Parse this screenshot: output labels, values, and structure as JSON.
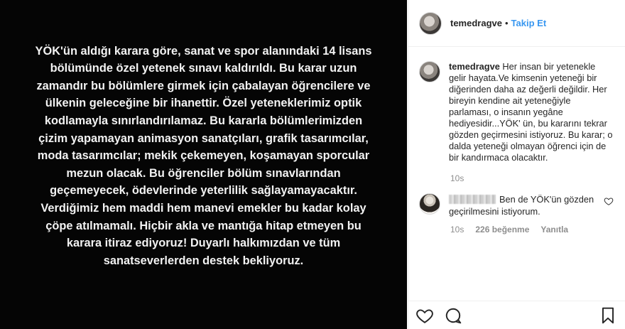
{
  "post": {
    "image_text": "YÖK'ün aldığı karara göre, sanat ve spor alanındaki 14 lisans\nbölümünde özel yetenek sınavı kaldırıldı. Bu karar uzun\nzamandır bu bölümlere girmek için çabalayan öğrencilere ve\nülkenin geleceğine bir ihanettir. Özel yeteneklerimiz optik\nkodlamayla sınırlandırılamaz. Bu kararla bölümlerimizden\nçizim yapamayan animasyon sanatçıları, grafik tasarımcılar,\nmoda tasarımcılar; mekik çekemeyen, koşamayan sporcular\nmezun olacak. Bu öğrenciler bölüm sınavlarından\ngeçemeyecek, ödevlerinde yeterlilik sağlayamayacaktır.\nVerdiğimiz hem maddi hem manevi emekler bu kadar kolay\nçöpe atılmamalı. Hiçbir akla ve mantığa hitap etmeyen bu\nkarara itiraz ediyoruz! Duyarlı halkımızdan ve tüm\nsanatseverlerden destek bekliyoruz."
  },
  "header": {
    "username": "temedragve",
    "separator": "•",
    "follow_label": "Takip Et"
  },
  "caption": {
    "username": "temedragve",
    "text": "Her insan bir yetenekle gelir hayata.Ve kimsenin yeteneği bir diğerinden daha az değerli değildir. Her bireyin kendine ait yeteneğiyle parlaması, o insanın yegâne hediyesidir...YÖK' ün, bu kararını tekrar gözden geçirmesini istiyoruz. Bu karar; o dalda yeteneği olmayan öğrenci için de bir kandırmaca olacaktır.",
    "time": "10s"
  },
  "reply": {
    "text": "Ben de YÖK'ün gözden geçirilmesini istiyorum.",
    "time": "10s",
    "likes": "226 beğenme",
    "reply_label": "Yanıtla"
  },
  "icons": {
    "like": "heart-icon",
    "comment": "comment-icon",
    "save": "bookmark-icon",
    "comment_like": "heart-icon"
  }
}
